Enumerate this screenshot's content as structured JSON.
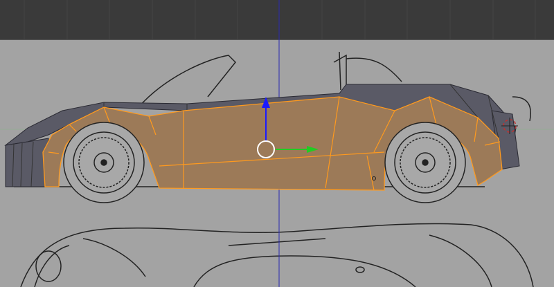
{
  "viewport": {
    "header_bg": "#3a3a3a",
    "canvas_bg": "#a3a3a3",
    "z_axis_color": "#2a2ab0",
    "x_axis_color": "#7fbf7f"
  },
  "mesh": {
    "selected_face_color": "#9c7a58",
    "unselected_face_color": "#5a5a66",
    "selected_edge_color": "#ff9a1e"
  },
  "gizmo": {
    "icons": [
      "move-z-arrow-icon",
      "move-x-arrow-icon",
      "pivot-circle-icon"
    ],
    "z_color": "#1a1aff",
    "x_color": "#22cc22"
  }
}
